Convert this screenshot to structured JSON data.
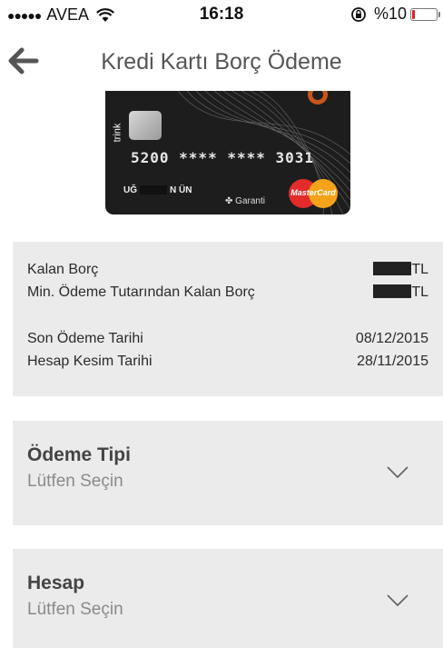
{
  "status_bar": {
    "signal_dots": "●●●●●",
    "carrier": "AVEA",
    "time": "16:18",
    "battery_text": "%10",
    "battery_level": 0.1,
    "battery_color": "#e0202a"
  },
  "header": {
    "title": "Kredi Kartı Borç Ödeme",
    "back_icon": "arrow-left-icon"
  },
  "card": {
    "brand_vertical": "trink",
    "number": "5200  ****  ****  3031",
    "holder_start": "UĞ",
    "holder_end": "N ÜN",
    "bank": "Garanti",
    "network": "MasterCard"
  },
  "summary": {
    "remaining_debt_label": "Kalan Borç",
    "remaining_debt_unit": "TL",
    "min_payment_label": "Min. Ödeme Tutarından Kalan Borç",
    "min_payment_unit": "TL",
    "due_date_label": "Son Ödeme Tarihi",
    "due_date_value": "08/12/2015",
    "statement_date_label": "Hesap Kesim Tarihi",
    "statement_date_value": "28/11/2015"
  },
  "payment_type": {
    "title": "Ödeme Tipi",
    "placeholder": "Lütfen Seçin"
  },
  "account": {
    "title": "Hesap",
    "placeholder": "Lütfen Seçin"
  },
  "colors": {
    "panel_bg": "#ebebeb",
    "card_bg": "#1d1d1d"
  }
}
